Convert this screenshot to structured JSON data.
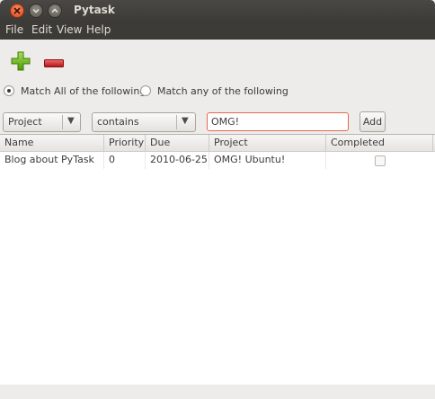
{
  "window": {
    "title": "Pytask"
  },
  "menu": {
    "items": [
      "File",
      "Edit",
      "View",
      "Help"
    ]
  },
  "toolbar": {
    "add_icon": "plus-icon",
    "remove_icon": "minus-icon",
    "colors": {
      "add": "#6fb51f",
      "remove": "#cc2222"
    }
  },
  "match": {
    "all_label": "Match All of the following",
    "any_label": "Match any of the following",
    "selected": "all"
  },
  "filter": {
    "field": "Project",
    "operator": "contains",
    "value": "OMG!",
    "add_label": "Add"
  },
  "table": {
    "columns": [
      "Name",
      "Priority",
      "Due",
      "Project",
      "Completed"
    ],
    "rows": [
      {
        "name": "Blog about PyTask",
        "priority": "0",
        "due": "2010-06-25",
        "project": "OMG! Ubuntu!",
        "completed": false
      }
    ]
  }
}
